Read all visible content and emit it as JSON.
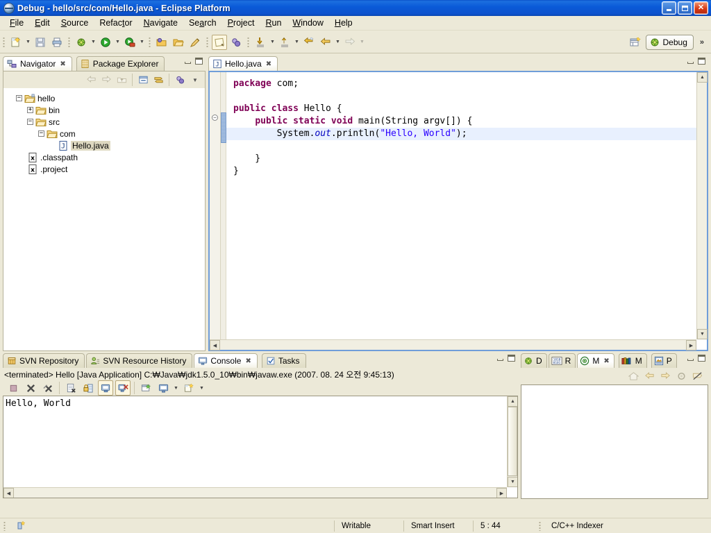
{
  "window": {
    "title": "Debug - hello/src/com/Hello.java - Eclipse Platform",
    "icon": "eclipse-icon",
    "buttons": {
      "minimize": "minimize-icon",
      "maximize": "maximize-icon",
      "close": "close-icon"
    }
  },
  "menubar": {
    "items": [
      {
        "label": "File",
        "mnemonic": "F"
      },
      {
        "label": "Edit",
        "mnemonic": "E"
      },
      {
        "label": "Source",
        "mnemonic": "S"
      },
      {
        "label": "Refactor",
        "mnemonic": "t"
      },
      {
        "label": "Navigate",
        "mnemonic": "N"
      },
      {
        "label": "Search",
        "mnemonic": "a"
      },
      {
        "label": "Project",
        "mnemonic": "P"
      },
      {
        "label": "Run",
        "mnemonic": "R"
      },
      {
        "label": "Window",
        "mnemonic": "W"
      },
      {
        "label": "Help",
        "mnemonic": "H"
      }
    ]
  },
  "toolbar": {
    "groups": [
      [
        "new-wizard-icon",
        "save-icon",
        "print-icon"
      ],
      [
        "debug-icon",
        "run-icon",
        "run-external-tools-icon"
      ],
      [
        "open-type-icon",
        "open-resource-icon",
        "search-icon"
      ],
      [
        "toggle-mark-occurrences-icon",
        "debug-perspective-icon"
      ],
      [
        "step-into-icon",
        "step-over-icon",
        "step-return-icon",
        "back-icon",
        "forward-icon"
      ]
    ],
    "overflow_label": "»"
  },
  "perspective": {
    "open_perspective_label": "open-perspective-icon",
    "active": "Debug",
    "active_icon": "debug-perspective-icon"
  },
  "navigator": {
    "tabs": [
      {
        "label": "Navigator",
        "icon": "navigator-icon",
        "active": true,
        "closable": true
      },
      {
        "label": "Package Explorer",
        "icon": "package-explorer-icon",
        "active": false,
        "closable": false
      }
    ],
    "toolbar_icons": [
      "back-icon",
      "forward-icon",
      "up-icon",
      "collapse-all-icon",
      "link-with-editor-icon",
      "view-menu-icon",
      "chevron-down-icon"
    ],
    "tree": [
      {
        "label": "hello",
        "icon": "project-folder-icon",
        "depth": 0,
        "expander": "-",
        "selected": false
      },
      {
        "label": "bin",
        "icon": "folder-icon",
        "depth": 1,
        "expander": "+",
        "selected": false
      },
      {
        "label": "src",
        "icon": "folder-icon",
        "depth": 1,
        "expander": "-",
        "selected": false
      },
      {
        "label": "com",
        "icon": "folder-icon",
        "depth": 2,
        "expander": "-",
        "selected": false
      },
      {
        "label": "Hello.java",
        "icon": "java-file-icon",
        "depth": 3,
        "expander": "",
        "selected": true
      },
      {
        "label": ".classpath",
        "icon": "xml-file-icon",
        "depth": 1,
        "expander": "",
        "selected": false
      },
      {
        "label": ".project",
        "icon": "xml-file-icon",
        "depth": 1,
        "expander": "",
        "selected": false
      }
    ]
  },
  "editor": {
    "tabs": [
      {
        "label": "Hello.java",
        "icon": "java-file-icon",
        "active": true,
        "closable": true
      }
    ],
    "code_lines": [
      {
        "line": 1,
        "tokens": [
          {
            "t": "package",
            "c": "kw"
          },
          {
            "t": " com;",
            "c": ""
          }
        ]
      },
      {
        "line": 2,
        "tokens": [
          {
            "t": "",
            "c": ""
          }
        ]
      },
      {
        "line": 3,
        "tokens": [
          {
            "t": "public class",
            "c": "kw"
          },
          {
            "t": " Hello {",
            "c": ""
          }
        ]
      },
      {
        "line": 4,
        "tokens": [
          {
            "t": "    ",
            "c": ""
          },
          {
            "t": "public static void",
            "c": "kw"
          },
          {
            "t": " main(String argv[]) {",
            "c": ""
          }
        ]
      },
      {
        "line": 5,
        "highlight": true,
        "tokens": [
          {
            "t": "        System.",
            "c": ""
          },
          {
            "t": "out",
            "c": "fld"
          },
          {
            "t": ".println(",
            "c": ""
          },
          {
            "t": "\"Hello, World\"",
            "c": "str"
          },
          {
            "t": ");",
            "c": ""
          }
        ]
      },
      {
        "line": 6,
        "tokens": [
          {
            "t": "    }",
            "c": ""
          }
        ]
      },
      {
        "line": 7,
        "tokens": [
          {
            "t": "}",
            "c": ""
          }
        ]
      }
    ]
  },
  "bottom": {
    "tabs": [
      {
        "label": "SVN Repository",
        "icon": "svn-repository-icon",
        "active": false,
        "closable": false
      },
      {
        "label": "SVN Resource History",
        "icon": "svn-history-icon",
        "active": false,
        "closable": false
      },
      {
        "label": "Console",
        "icon": "console-icon",
        "active": true,
        "closable": true
      },
      {
        "label": "Tasks",
        "icon": "tasks-icon",
        "active": false,
        "closable": false
      }
    ],
    "launch_header": "<terminated> Hello [Java Application] C:₩Java₩jdk1.5.0_10₩bin₩javaw.exe (2007. 08. 24 오전 9:45:13)",
    "toolbar_icons": [
      "terminate-icon",
      "remove-launch-icon",
      "remove-all-terminated-icon",
      "clear-console-icon",
      "scroll-lock-icon",
      "pin-console-icon",
      "display-selected-console-icon",
      "open-console-icon",
      "new-console-view-icon"
    ],
    "output": "Hello, World"
  },
  "rightpanel": {
    "tabs": [
      {
        "label": "D",
        "icon": "debug-view-icon",
        "active": false,
        "closable": false
      },
      {
        "label": "R",
        "icon": "registers-view-icon",
        "active": false,
        "closable": false
      },
      {
        "label": "M",
        "icon": "memory-view-icon",
        "active": true,
        "closable": true
      },
      {
        "label": "M",
        "icon": "modules-view-icon",
        "active": false,
        "closable": false
      },
      {
        "label": "P",
        "icon": "problems-view-icon",
        "active": false,
        "closable": false
      }
    ],
    "toolbar_icons": [
      "home-icon",
      "back-icon",
      "forward-icon",
      "refresh-icon",
      "link-off-icon"
    ]
  },
  "statusbar": {
    "left_icon": "editor-status-icon",
    "cells": [
      "Writable",
      "Smart Insert",
      "5 : 44",
      "C/C++ Indexer"
    ]
  },
  "colors": {
    "title_blue": "#0a5ad8",
    "chrome": "#ece9d8",
    "tab_border": "#b6b29a",
    "editor_border": "#6f9dd9",
    "keyword": "#7f0055",
    "string": "#2a00ff",
    "field": "#0000c0",
    "current_line": "#e8f0fe",
    "selection": "#ded8c0"
  }
}
